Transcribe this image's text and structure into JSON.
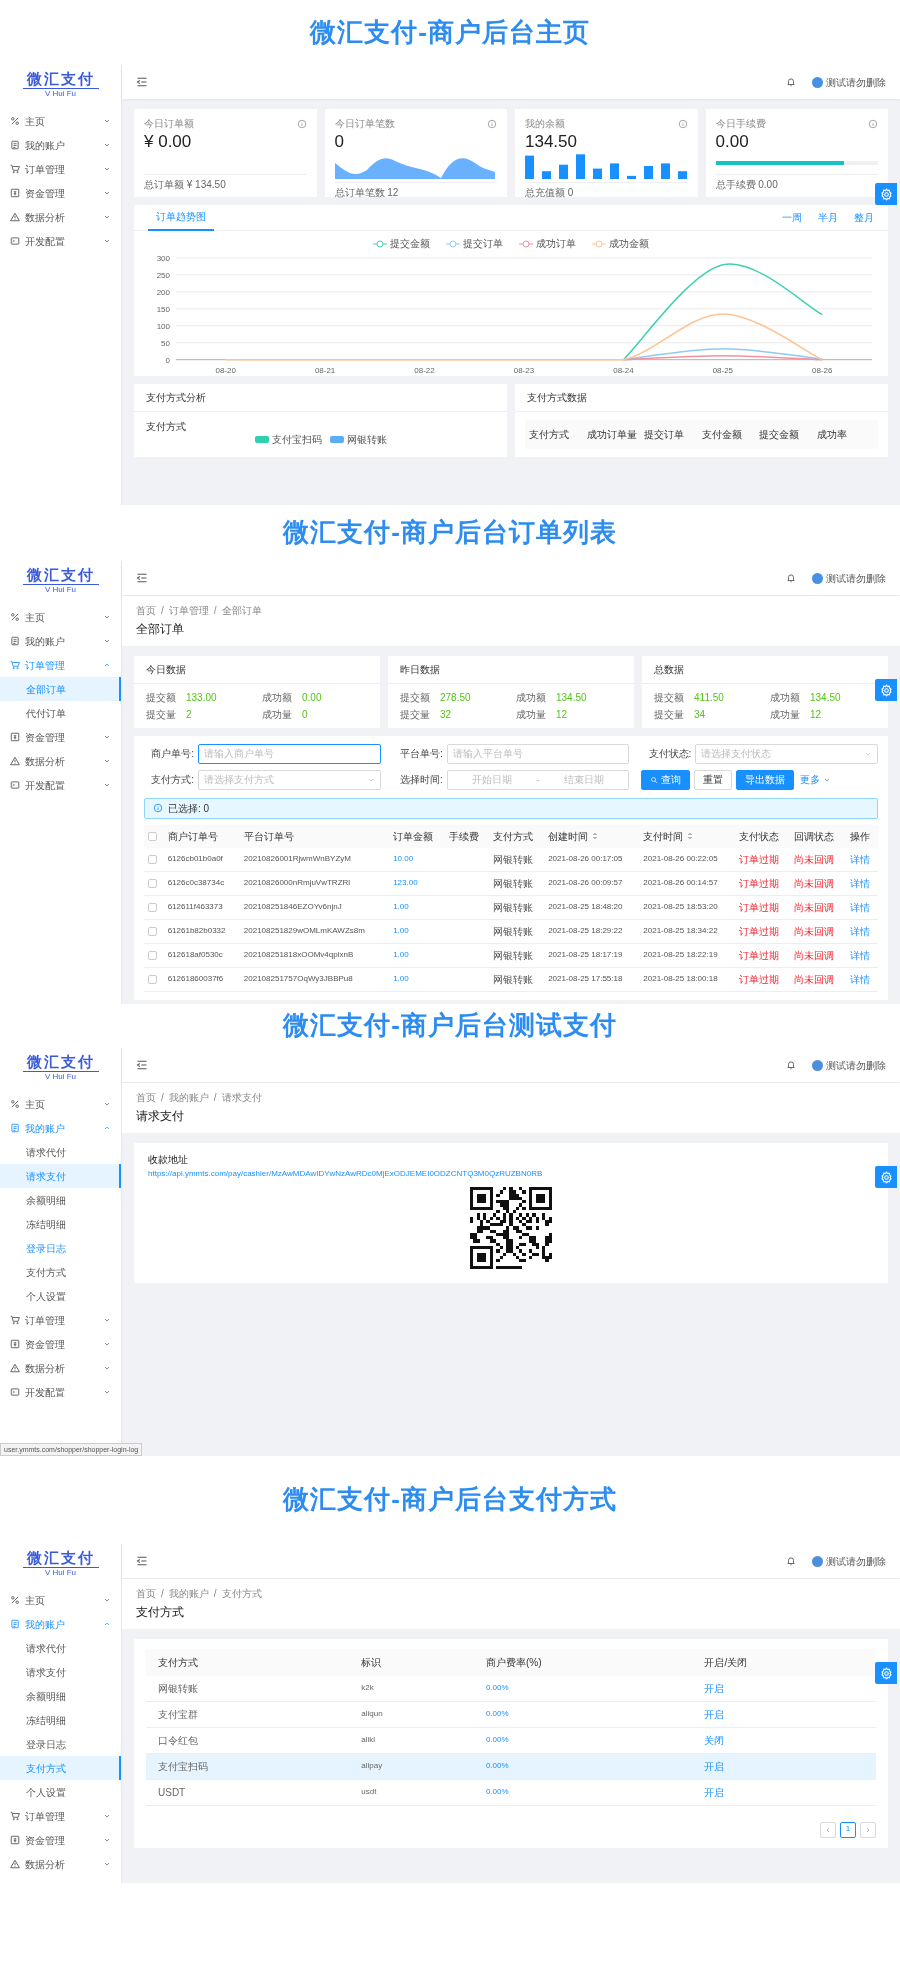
{
  "sections": [
    {
      "heading": "微汇支付-商户后台主页",
      "kind": "dashboard",
      "logo": {
        "title": "微汇支付",
        "subtitle": "V Hui Fu"
      },
      "user": "测试请勿删除",
      "sidebar": [
        {
          "label": "主页",
          "expanded": false
        },
        {
          "label": "我的账户",
          "expanded": false
        },
        {
          "label": "订单管理",
          "expanded": false
        },
        {
          "label": "资金管理",
          "expanded": false
        },
        {
          "label": "数据分析",
          "expanded": false
        },
        {
          "label": "开发配置",
          "expanded": false
        }
      ],
      "stats": [
        {
          "title": "今日订单额",
          "value": "¥ 0.00",
          "footer": "总订单额 ¥ 134.50",
          "kind": "plain"
        },
        {
          "title": "今日订单笔数",
          "value": "0",
          "footer": "总订单笔数 12",
          "kind": "area"
        },
        {
          "title": "我的余额",
          "value": "134.50",
          "footer": "总充值额 0",
          "kind": "bars"
        },
        {
          "title": "今日手续费",
          "value": "0.00",
          "footer": "总手续费 0.00",
          "kind": "progress",
          "level": 0.79
        }
      ],
      "trend": {
        "tabs": [
          {
            "label": "订单趋势图",
            "selected": true
          }
        ],
        "ranges": [
          "一周",
          "半月",
          "整月"
        ],
        "chart_data": {
          "type": "line",
          "grid": true,
          "categories": [
            "08-20",
            "08-21",
            "08-22",
            "08-23",
            "08-24",
            "08-25",
            "08-26"
          ],
          "ylim": [
            0,
            300
          ],
          "yticks": [
            0,
            50,
            100,
            150,
            200,
            250,
            300
          ],
          "series": [
            {
              "name": "提交金额",
              "color": "#3fd1b1",
              "values": [
                null,
                null,
                null,
                null,
                0,
                280,
                133
              ]
            },
            {
              "name": "提交订单",
              "color": "#8ecbf4",
              "values": [
                null,
                null,
                null,
                null,
                0,
                32,
                2
              ]
            },
            {
              "name": "成功订单",
              "color": "#f5909f",
              "values": [
                null,
                null,
                null,
                null,
                0,
                12,
                0
              ]
            },
            {
              "name": "成功金额",
              "color": "#ffc391",
              "values": [
                0,
                0,
                0,
                0,
                0,
                135,
                0
              ]
            }
          ]
        }
      },
      "panels": [
        {
          "title": "支付方式分析",
          "label": "支付方式",
          "legend": [
            {
              "label": "支付宝扫码",
              "color": "#2fd0ae"
            },
            {
              "label": "网银转账",
              "color": "#5aaef5"
            }
          ]
        },
        {
          "title": "支付方式数据",
          "columns": [
            "支付方式",
            "成功订单量",
            "提交订单",
            "支付金额",
            "提交金额",
            "成功率"
          ]
        }
      ]
    },
    {
      "heading": "微汇支付-商户后台订单列表",
      "kind": "orders",
      "logo": {
        "title": "微汇支付",
        "subtitle": "V Hui Fu"
      },
      "user": "测试请勿删除",
      "sidebar": [
        {
          "label": "主页",
          "expanded": false
        },
        {
          "label": "我的账户",
          "expanded": false
        },
        {
          "label": "订单管理",
          "expanded": true,
          "children": [
            {
              "label": "全部订单",
              "selected": true
            },
            {
              "label": "代付订单",
              "selected": false
            }
          ]
        },
        {
          "label": "资金管理",
          "expanded": false
        },
        {
          "label": "数据分析",
          "expanded": false
        },
        {
          "label": "开发配置",
          "expanded": false
        }
      ],
      "breadcrumb": [
        "首页",
        "订单管理",
        "全部订单"
      ],
      "separator": "/",
      "page_title": "全部订单",
      "summary": [
        {
          "title": "今日数据",
          "items": [
            {
              "label": "提交额",
              "value": "133.00"
            },
            {
              "label": "成功额",
              "value": "0.00"
            },
            {
              "label": "提交量",
              "value": "2"
            },
            {
              "label": "成功量",
              "value": "0"
            }
          ]
        },
        {
          "title": "昨日数据",
          "items": [
            {
              "label": "提交额",
              "value": "278.50"
            },
            {
              "label": "成功额",
              "value": "134.50"
            },
            {
              "label": "提交量",
              "value": "32"
            },
            {
              "label": "成功量",
              "value": "12"
            }
          ]
        },
        {
          "title": "总数据",
          "items": [
            {
              "label": "提交额",
              "value": "411.50"
            },
            {
              "label": "成功额",
              "value": "134.50"
            },
            {
              "label": "提交量",
              "value": "34"
            },
            {
              "label": "成功量",
              "value": "12"
            }
          ]
        }
      ],
      "filters": [
        {
          "label": "商户单号:",
          "kind": "text",
          "placeholder": "请输入商户单号",
          "focused": true
        },
        {
          "label": "平台单号:",
          "kind": "text",
          "placeholder": "请输入平台单号",
          "focused": false
        },
        {
          "label": "支付状态:",
          "kind": "select",
          "placeholder": "请选择支付状态"
        },
        {
          "label": "支付方式:",
          "kind": "select",
          "placeholder": "请选择支付方式"
        },
        {
          "label": "选择时间:",
          "kind": "daterange",
          "start": {
            "placeholder": "开始日期"
          },
          "separator": "-",
          "end": {
            "placeholder": "结束日期"
          }
        }
      ],
      "actions": [
        {
          "label": "查询",
          "kind": "primary"
        },
        {
          "label": "重置",
          "kind": "default"
        },
        {
          "label": "导出数据",
          "kind": "primary"
        },
        {
          "label": "更多",
          "kind": "link"
        }
      ],
      "selection_note": "已选择: 0",
      "table": {
        "select_all": false,
        "columns": [
          {
            "label": "商户订单号",
            "sortable": false
          },
          {
            "label": "平台订单号",
            "sortable": false
          },
          {
            "label": "订单金额",
            "sortable": false
          },
          {
            "label": "手续费",
            "sortable": false
          },
          {
            "label": "支付方式",
            "sortable": false
          },
          {
            "label": "创建时间",
            "sortable": true
          },
          {
            "label": "支付时间",
            "sortable": true
          },
          {
            "label": "支付状态",
            "sortable": false
          },
          {
            "label": "回调状态",
            "sortable": false
          },
          {
            "label": "操作",
            "sortable": false
          }
        ],
        "rows": [
          {
            "checked": false,
            "merchant_no": "6126cb01b0a0f",
            "platform_no": "20210826001RjwmWnBYZyM",
            "amount": "10.00",
            "method": "网银转账",
            "created": "2021-08-26 00:17:05",
            "paid": "2021-08-26 00:22:05",
            "pay_status": "订单过期",
            "callback_status": "尚未回调",
            "action": "详情"
          },
          {
            "checked": false,
            "merchant_no": "6126c0c38734c",
            "platform_no": "20210826000nRmjuVwTRZRl",
            "amount": "123.00",
            "method": "网银转账",
            "created": "2021-08-26 00:09:57",
            "paid": "2021-08-26 00:14:57",
            "pay_status": "订单过期",
            "callback_status": "尚未回调",
            "action": "详情"
          },
          {
            "checked": false,
            "merchant_no": "612611f463373",
            "platform_no": "202108251846EZOYv6njnJ",
            "amount": "1.00",
            "method": "网银转账",
            "created": "2021-08-25 18:48:20",
            "paid": "2021-08-25 18:53:20",
            "pay_status": "订单过期",
            "callback_status": "尚未回调",
            "action": "详情"
          },
          {
            "checked": false,
            "merchant_no": "61261b82b0332",
            "platform_no": "202108251829wOMLmKAWZs8m",
            "amount": "1.00",
            "method": "网银转账",
            "created": "2021-08-25 18:29:22",
            "paid": "2021-08-25 18:34:22",
            "pay_status": "订单过期",
            "callback_status": "尚未回调",
            "action": "详情"
          },
          {
            "checked": false,
            "merchant_no": "612618af0530c",
            "platform_no": "202108251818xOOMv4qplxnB",
            "amount": "1.00",
            "method": "网银转账",
            "created": "2021-08-25 18:17:19",
            "paid": "2021-08-25 18:22:19",
            "pay_status": "订单过期",
            "callback_status": "尚未回调",
            "action": "详情"
          },
          {
            "checked": false,
            "merchant_no": "61261860037f6",
            "platform_no": "202108251757OqWy3JBBPu8",
            "amount": "1.00",
            "method": "网银转账",
            "created": "2021-08-25 17:55:18",
            "paid": "2021-08-25 18:00:18",
            "pay_status": "订单过期",
            "callback_status": "尚未回调",
            "action": "详情"
          }
        ]
      }
    },
    {
      "heading": "微汇支付-商户后台测试支付",
      "kind": "pay_request",
      "logo": {
        "title": "微汇支付",
        "subtitle": "V Hui Fu"
      },
      "user": "测试请勿删除",
      "sidebar": [
        {
          "label": "主页",
          "expanded": false
        },
        {
          "label": "我的账户",
          "expanded": true,
          "children": [
            {
              "label": "请求代付",
              "selected": false,
              "hovered": false
            },
            {
              "label": "请求支付",
              "selected": true,
              "hovered": false
            },
            {
              "label": "余额明细",
              "selected": false,
              "hovered": false
            },
            {
              "label": "冻结明细",
              "selected": false,
              "hovered": false
            },
            {
              "label": "登录日志",
              "selected": false,
              "hovered": true
            },
            {
              "label": "支付方式",
              "selected": false,
              "hovered": false
            },
            {
              "label": "个人设置",
              "selected": false,
              "hovered": false
            }
          ]
        },
        {
          "label": "订单管理",
          "expanded": false
        },
        {
          "label": "资金管理",
          "expanded": false
        },
        {
          "label": "数据分析",
          "expanded": false
        },
        {
          "label": "开发配置",
          "expanded": false
        }
      ],
      "breadcrumb": [
        "首页",
        "我的账户",
        "请求支付"
      ],
      "separator": "/",
      "page_title": "请求支付",
      "pay_card": {
        "label": "收款地址",
        "url": "https://api.ymmts.com/pay/cashier/MzAwMDAwIDYwNzAwRDc0MjExODJEMEI0ODZCNTQ3M0QzRUZBN0RB"
      },
      "status_url": "user.ymmts.com/shopper/shopper-login-log"
    },
    {
      "heading": "微汇支付-商户后台支付方式",
      "kind": "pay_methods",
      "logo": {
        "title": "微汇支付",
        "subtitle": "V Hui Fu"
      },
      "user": "测试请勿删除",
      "sidebar": [
        {
          "label": "主页",
          "expanded": false
        },
        {
          "label": "我的账户",
          "expanded": true,
          "children": [
            {
              "label": "请求代付",
              "selected": false,
              "hovered": false
            },
            {
              "label": "请求支付",
              "selected": false,
              "hovered": false
            },
            {
              "label": "余额明细",
              "selected": false,
              "hovered": false
            },
            {
              "label": "冻结明细",
              "selected": false,
              "hovered": false
            },
            {
              "label": "登录日志",
              "selected": false,
              "hovered": false
            },
            {
              "label": "支付方式",
              "selected": true,
              "hovered": false
            },
            {
              "label": "个人设置",
              "selected": false,
              "hovered": false
            }
          ]
        },
        {
          "label": "订单管理",
          "expanded": false
        },
        {
          "label": "资金管理",
          "expanded": false
        },
        {
          "label": "数据分析",
          "expanded": false
        }
      ],
      "breadcrumb": [
        "首页",
        "我的账户",
        "支付方式"
      ],
      "separator": "/",
      "page_title": "支付方式",
      "table": {
        "columns": [
          "支付方式",
          "标识",
          "商户费率(%)",
          "开启/关闭"
        ],
        "rows": [
          {
            "name": "网银转账",
            "code": "k2k",
            "rate": "0.00%",
            "status": "开启",
            "highlighted": false
          },
          {
            "name": "支付宝群",
            "code": "aliqun",
            "rate": "0.00%",
            "status": "开启",
            "highlighted": false
          },
          {
            "name": "口令红包",
            "code": "alikl",
            "rate": "0.00%",
            "status": "关闭",
            "highlighted": false
          },
          {
            "name": "支付宝扫码",
            "code": "alipay",
            "rate": "0.00%",
            "status": "开启",
            "highlighted": true
          },
          {
            "name": "USDT",
            "code": "usdt",
            "rate": "0.00%",
            "status": "开启",
            "highlighted": false
          }
        ]
      },
      "pagination": [
        {
          "label": "1",
          "selected": true
        }
      ]
    }
  ]
}
